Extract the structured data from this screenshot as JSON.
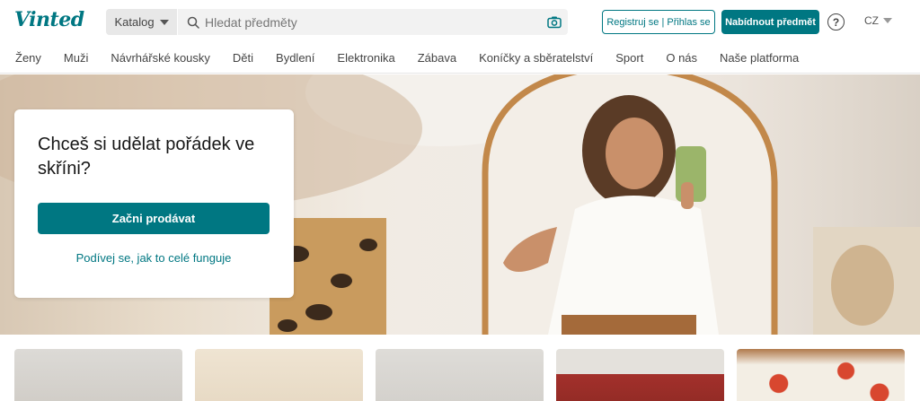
{
  "header": {
    "logo_text": "Vinted",
    "catalog_label": "Katalog",
    "search_placeholder": "Hledat předměty",
    "register_label": "Registruj se | Přihlas se",
    "sell_label": "Nabídnout předmět",
    "help_label": "?",
    "language": "CZ"
  },
  "nav": {
    "items": [
      "Ženy",
      "Muži",
      "Návrhářské kousky",
      "Děti",
      "Bydlení",
      "Elektronika",
      "Zábava",
      "Koníčky a sběratelství",
      "Sport",
      "O nás",
      "Naše platforma"
    ]
  },
  "hero": {
    "title": "Chceš si udělat pořádek ve skříni?",
    "cta_label": "Začni prodávat",
    "link_label": "Podívej se, jak to celé funguje"
  },
  "colors": {
    "brand": "#007782"
  },
  "icons": [
    "search-icon",
    "camera-icon",
    "help-icon",
    "caret-down-icon"
  ]
}
